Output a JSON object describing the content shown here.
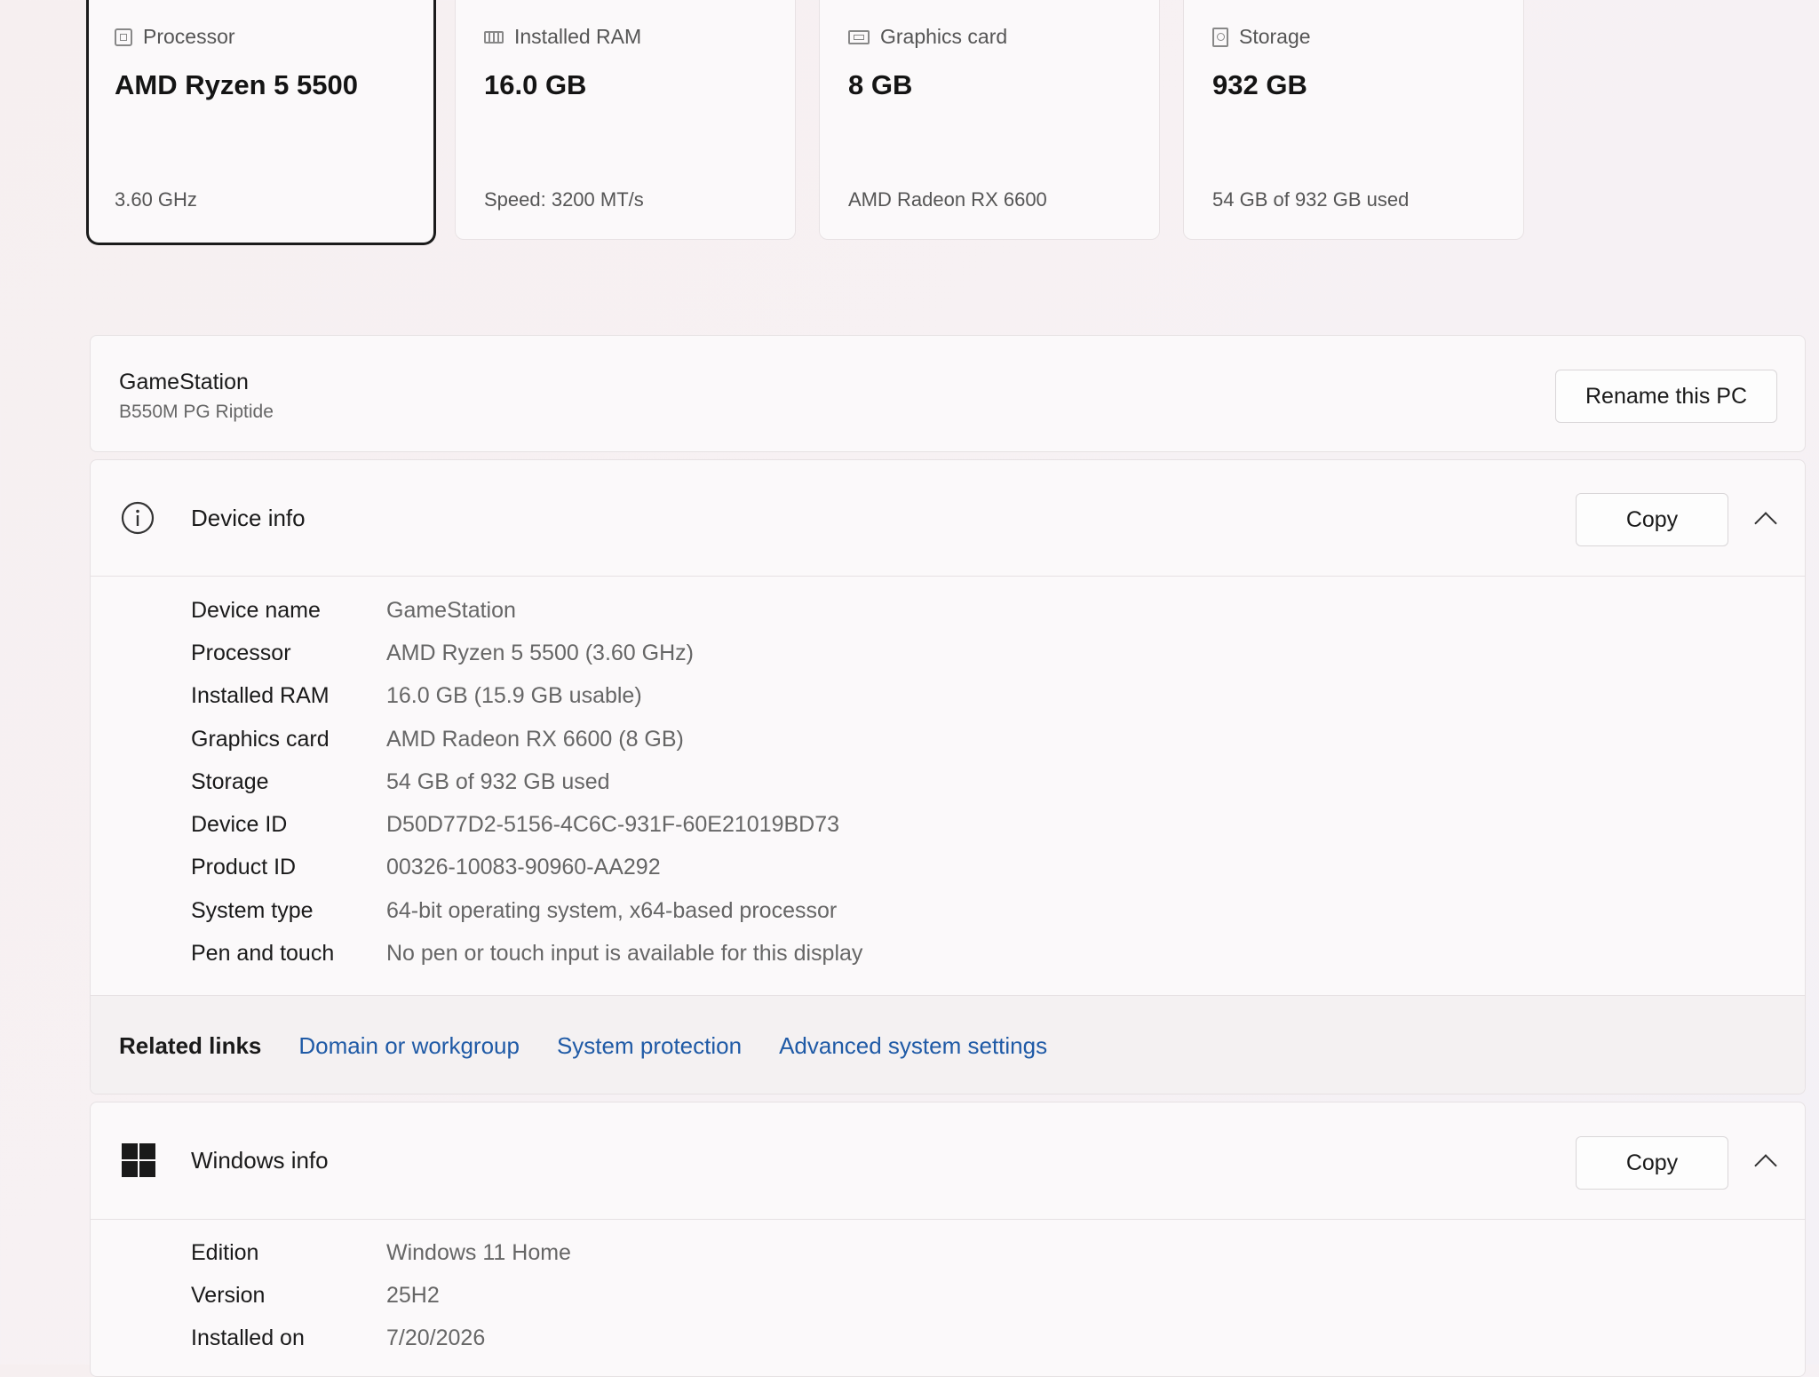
{
  "spec_cards": [
    {
      "icon": "cpu-icon",
      "title": "Processor",
      "value": "AMD Ryzen 5 5500",
      "detail": "3.60 GHz"
    },
    {
      "icon": "ram-icon",
      "title": "Installed RAM",
      "value": "16.0 GB",
      "detail": "Speed: 3200 MT/s"
    },
    {
      "icon": "graphics-card-icon",
      "title": "Graphics card",
      "value": "8 GB",
      "detail": "AMD Radeon RX 6600"
    },
    {
      "icon": "storage-icon",
      "title": "Storage",
      "value": "932 GB",
      "detail": "54 GB of 932 GB used"
    }
  ],
  "pc": {
    "name": "GameStation",
    "model": "B550M PG Riptide",
    "rename_label": "Rename this PC"
  },
  "device_info": {
    "title": "Device info",
    "copy_label": "Copy",
    "rows": [
      {
        "key": "Device name",
        "value": "GameStation"
      },
      {
        "key": "Processor",
        "value": "AMD Ryzen 5 5500 (3.60 GHz)"
      },
      {
        "key": "Installed RAM",
        "value": "16.0 GB (15.9 GB usable)"
      },
      {
        "key": "Graphics card",
        "value": "AMD Radeon RX 6600 (8 GB)"
      },
      {
        "key": "Storage",
        "value": "54 GB of 932 GB used"
      },
      {
        "key": "Device ID",
        "value": "D50D77D2-5156-4C6C-931F-60E21019BD73"
      },
      {
        "key": "Product ID",
        "value": "00326-10083-90960-AA292"
      },
      {
        "key": "System type",
        "value": "64-bit operating system, x64-based processor"
      },
      {
        "key": "Pen and touch",
        "value": "No pen or touch input is available for this display"
      }
    ]
  },
  "related_links": {
    "label": "Related links",
    "links": [
      "Domain or workgroup",
      "System protection",
      "Advanced system settings"
    ]
  },
  "windows_info": {
    "title": "Windows info",
    "copy_label": "Copy",
    "rows": [
      {
        "key": "Edition",
        "value": "Windows 11 Home"
      },
      {
        "key": "Version",
        "value": "25H2"
      },
      {
        "key": "Installed on",
        "value": "7/20/2026"
      }
    ]
  }
}
